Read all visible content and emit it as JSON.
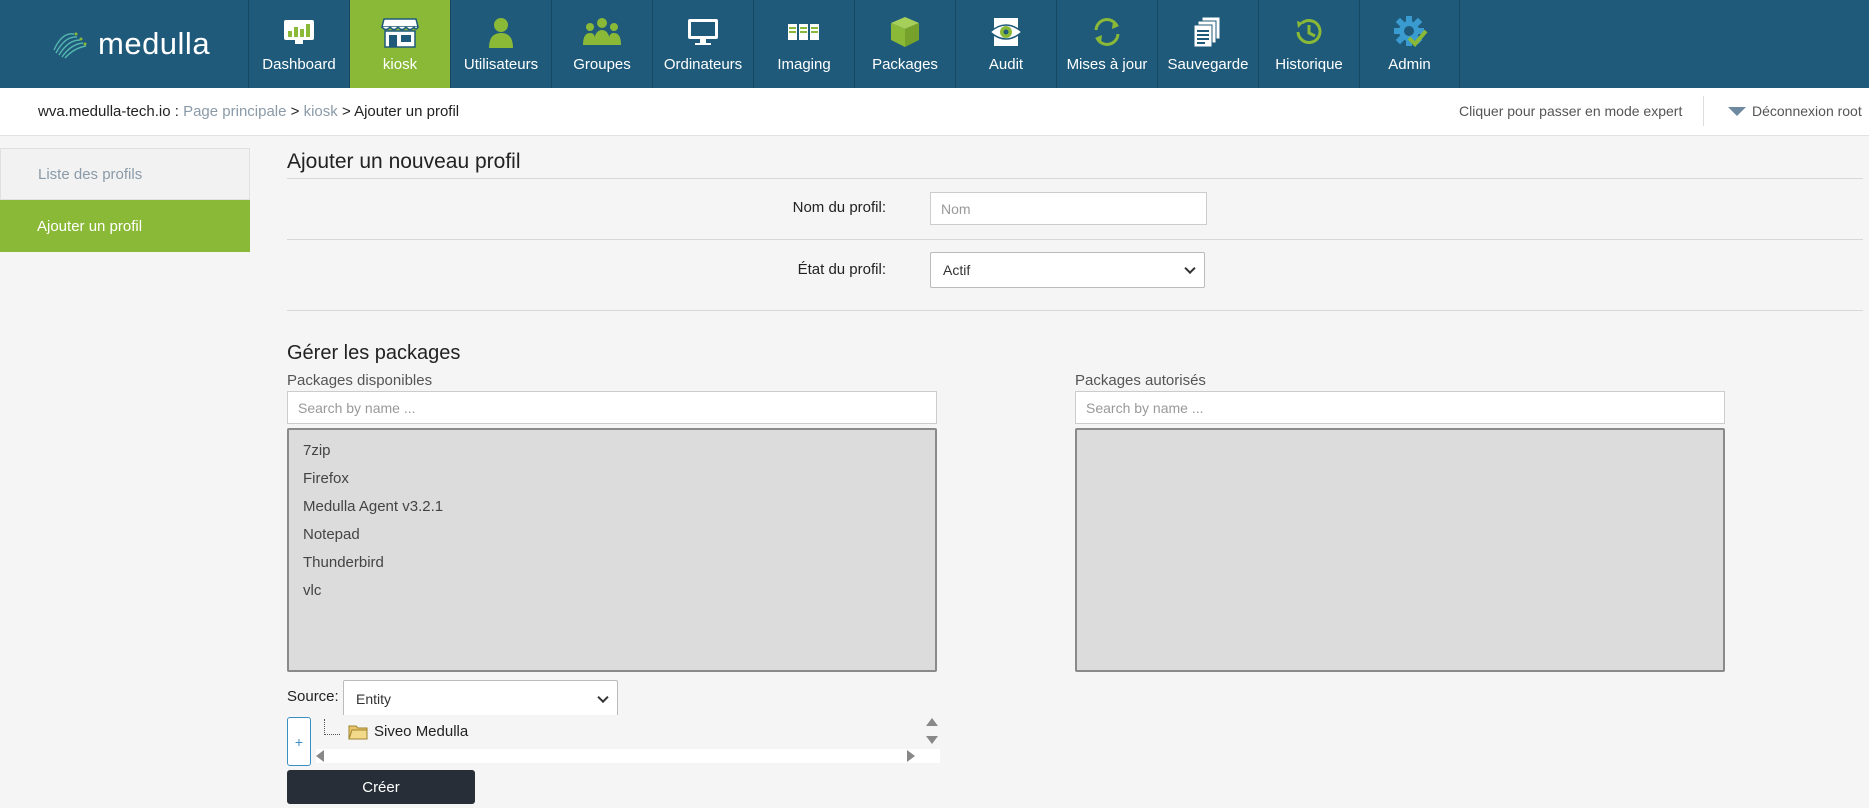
{
  "brand": {
    "name": "medulla"
  },
  "nav": {
    "items": [
      {
        "label": "Dashboard",
        "icon": "dashboard-icon"
      },
      {
        "label": "kiosk",
        "icon": "kiosk-icon",
        "active": true
      },
      {
        "label": "Utilisateurs",
        "icon": "user-icon"
      },
      {
        "label": "Groupes",
        "icon": "group-icon"
      },
      {
        "label": "Ordinateurs",
        "icon": "monitor-icon"
      },
      {
        "label": "Imaging",
        "icon": "imaging-icon"
      },
      {
        "label": "Packages",
        "icon": "packages-icon"
      },
      {
        "label": "Audit",
        "icon": "audit-icon"
      },
      {
        "label": "Mises à jour",
        "icon": "update-icon"
      },
      {
        "label": "Sauvegarde",
        "icon": "backup-icon"
      },
      {
        "label": "Historique",
        "icon": "history-icon"
      },
      {
        "label": "Admin",
        "icon": "admin-gear-icon"
      }
    ]
  },
  "breadcrumb": {
    "host": "wva.medulla-tech.io",
    "sep1": " : ",
    "home": "Page principale",
    "sep2": " > ",
    "module": "kiosk",
    "sep3": " > ",
    "current": "Ajouter un profil"
  },
  "header_right": {
    "expert": "Cliquer pour passer en mode expert",
    "logout": "Déconnexion root"
  },
  "sidebar": {
    "items": [
      {
        "label": "Liste des profils"
      },
      {
        "label": "Ajouter un profil",
        "active": true
      }
    ]
  },
  "form": {
    "title": "Ajouter un nouveau profil",
    "name_label": "Nom du profil:",
    "name_placeholder": "Nom",
    "name_value": "",
    "status_label": "État du profil:",
    "status_value": "Actif"
  },
  "packages": {
    "title": "Gérer les packages",
    "available_label": "Packages disponibles",
    "available_search_placeholder": "Search by name ...",
    "available": [
      "7zip",
      "Firefox",
      "Medulla Agent v3.2.1",
      "Notepad",
      "Thunderbird",
      "vlc"
    ],
    "authorized_label": "Packages autorisés",
    "authorized_search_placeholder": "Search by name ...",
    "authorized": []
  },
  "source": {
    "label": "Source:",
    "value": "Entity",
    "expand": "+",
    "tree_root": "Siveo Medulla"
  },
  "create_button": "Créer",
  "colors": {
    "topbar": "#1f5a7a",
    "accent": "#8ab937",
    "button_dark": "#272e37"
  }
}
